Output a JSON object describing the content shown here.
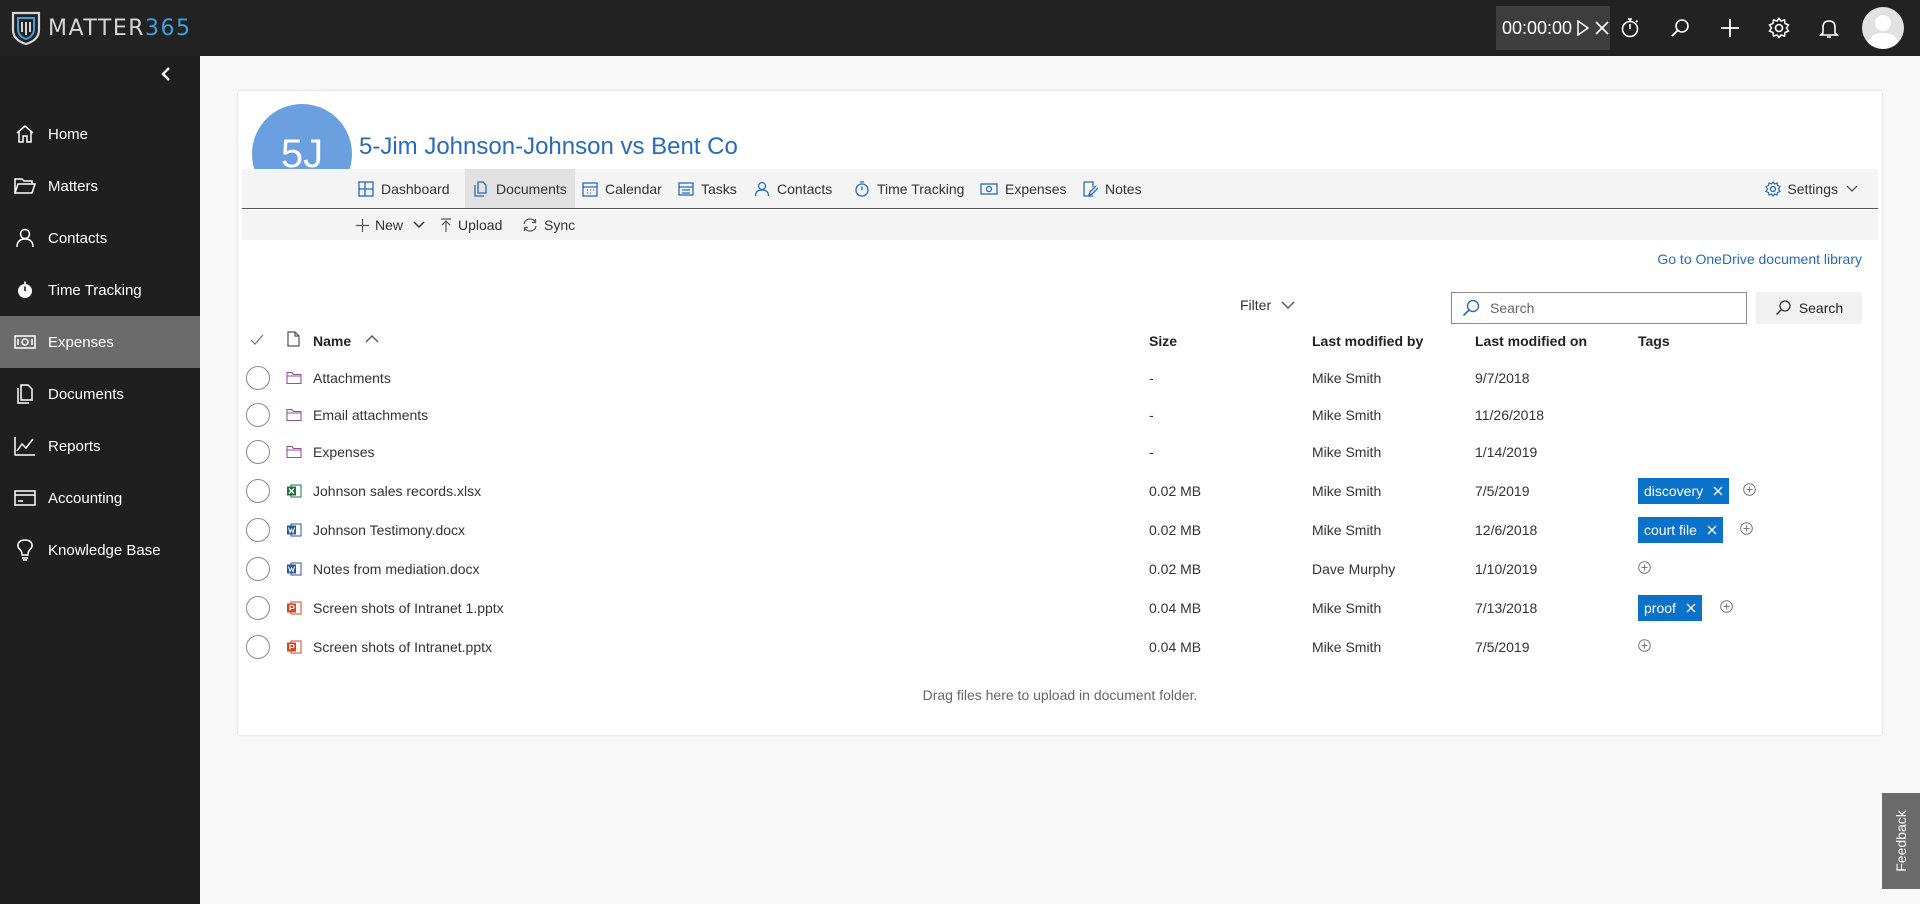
{
  "app": {
    "logo_word": "MATTER",
    "logo_num": "365"
  },
  "timer": {
    "value": "00:00:00"
  },
  "sidebar": {
    "items": [
      {
        "label": "Home",
        "icon": "home-icon"
      },
      {
        "label": "Matters",
        "icon": "folder-open-icon"
      },
      {
        "label": "Contacts",
        "icon": "person-icon"
      },
      {
        "label": "Time Tracking",
        "icon": "stopwatch-icon"
      },
      {
        "label": "Expenses",
        "icon": "money-icon",
        "active": true
      },
      {
        "label": "Documents",
        "icon": "documents-icon"
      },
      {
        "label": "Reports",
        "icon": "chart-icon"
      },
      {
        "label": "Accounting",
        "icon": "card-icon"
      },
      {
        "label": "Knowledge Base",
        "icon": "lightbulb-icon"
      }
    ]
  },
  "matter": {
    "initials": "5J",
    "title": "5-Jim Johnson-Johnson vs Bent Co"
  },
  "tabs": [
    {
      "label": "Dashboard"
    },
    {
      "label": "Documents",
      "active": true
    },
    {
      "label": "Calendar"
    },
    {
      "label": "Tasks"
    },
    {
      "label": "Contacts"
    },
    {
      "label": "Time Tracking"
    },
    {
      "label": "Expenses"
    },
    {
      "label": "Notes"
    }
  ],
  "settings_label": "Settings",
  "commands": {
    "new": "New",
    "upload": "Upload",
    "sync": "Sync"
  },
  "onedrive_link": "Go to OneDrive document library",
  "filter_label": "Filter",
  "search": {
    "placeholder": "Search",
    "button_label": "Search"
  },
  "columns": {
    "name": "Name",
    "size": "Size",
    "modified_by": "Last modified by",
    "modified_on": "Last modified on",
    "tags": "Tags"
  },
  "files": [
    {
      "name": "Attachments",
      "type": "folder",
      "size": "-",
      "modified_by": "Mike Smith",
      "modified_on": "9/7/2018",
      "tag": null
    },
    {
      "name": "Email attachments",
      "type": "folder",
      "size": "-",
      "modified_by": "Mike Smith",
      "modified_on": "11/26/2018",
      "tag": null
    },
    {
      "name": "Expenses",
      "type": "folder",
      "size": "-",
      "modified_by": "Mike Smith",
      "modified_on": "1/14/2019",
      "tag": null
    },
    {
      "name": "Johnson sales records.xlsx",
      "type": "xlsx",
      "size": "0.02 MB",
      "modified_by": "Mike Smith",
      "modified_on": "7/5/2019",
      "tag": "discovery"
    },
    {
      "name": "Johnson Testimony.docx",
      "type": "docx",
      "size": "0.02 MB",
      "modified_by": "Mike Smith",
      "modified_on": "12/6/2018",
      "tag": "court file"
    },
    {
      "name": "Notes from mediation.docx",
      "type": "docx",
      "size": "0.02 MB",
      "modified_by": "Dave Murphy",
      "modified_on": "1/10/2019",
      "tag": null
    },
    {
      "name": "Screen shots of Intranet 1.pptx",
      "type": "pptx",
      "size": "0.04 MB",
      "modified_by": "Mike Smith",
      "modified_on": "7/13/2018",
      "tag": "proof"
    },
    {
      "name": "Screen shots of Intranet.pptx",
      "type": "pptx",
      "size": "0.04 MB",
      "modified_by": "Mike Smith",
      "modified_on": "7/5/2019",
      "tag": null
    }
  ],
  "drop_note": "Drag files here to upload in document folder.",
  "feedback_label": "Feedback",
  "colors": {
    "topbar": "#222222",
    "sidebar": "#1f1f1f",
    "sidebar_active": "#6b6b6b",
    "accent": "#2a6bb8",
    "tag": "#0a73c9",
    "matter_avatar": "#6a9fe0"
  }
}
